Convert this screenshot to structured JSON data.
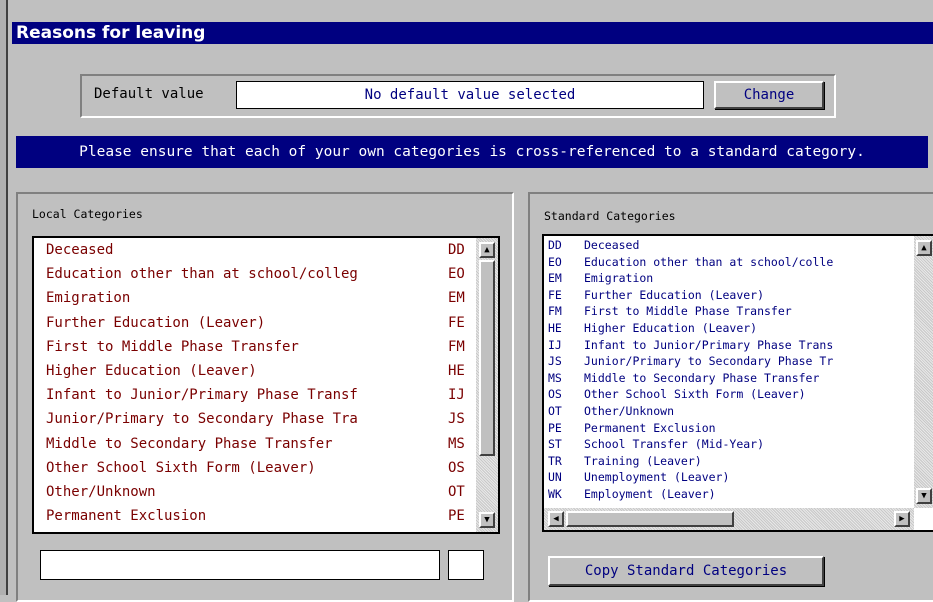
{
  "window": {
    "title": "Reasons for leaving"
  },
  "default_value": {
    "label": "Default value",
    "value": "No default value selected",
    "change_button": "Change"
  },
  "banner": "Please ensure that each of your own categories is cross-referenced to a standard category.",
  "local": {
    "title": "Local Categories",
    "items": [
      {
        "name": "Deceased",
        "code": "DD"
      },
      {
        "name": "Education other than at school/colleg",
        "code": "EO"
      },
      {
        "name": "Emigration",
        "code": "EM"
      },
      {
        "name": "Further Education (Leaver)",
        "code": "FE"
      },
      {
        "name": "First to Middle Phase Transfer",
        "code": "FM"
      },
      {
        "name": "Higher Education (Leaver)",
        "code": "HE"
      },
      {
        "name": "Infant to Junior/Primary Phase Transf",
        "code": "IJ"
      },
      {
        "name": "Junior/Primary to Secondary Phase Tra",
        "code": "JS"
      },
      {
        "name": "Middle to Secondary Phase Transfer",
        "code": "MS"
      },
      {
        "name": "Other School Sixth Form (Leaver)",
        "code": "OS"
      },
      {
        "name": "Other/Unknown",
        "code": "OT"
      },
      {
        "name": "Permanent Exclusion",
        "code": "PE"
      }
    ],
    "edit_name": "",
    "edit_code": ""
  },
  "standard": {
    "title": "Standard Categories",
    "items": [
      {
        "code": "DD",
        "name": "Deceased"
      },
      {
        "code": "EO",
        "name": "Education other than at school/colle"
      },
      {
        "code": "EM",
        "name": "Emigration"
      },
      {
        "code": "FE",
        "name": "Further Education (Leaver)"
      },
      {
        "code": "FM",
        "name": "First to Middle Phase Transfer"
      },
      {
        "code": "HE",
        "name": "Higher Education (Leaver)"
      },
      {
        "code": "IJ",
        "name": "Infant to Junior/Primary Phase Trans"
      },
      {
        "code": "JS",
        "name": "Junior/Primary to Secondary Phase Tr"
      },
      {
        "code": "MS",
        "name": "Middle to Secondary Phase Transfer"
      },
      {
        "code": "OS",
        "name": "Other School Sixth Form (Leaver)"
      },
      {
        "code": "OT",
        "name": "Other/Unknown"
      },
      {
        "code": "PE",
        "name": "Permanent Exclusion"
      },
      {
        "code": "ST",
        "name": "School Transfer (Mid-Year)"
      },
      {
        "code": "TR",
        "name": "Training (Leaver)"
      },
      {
        "code": "UN",
        "name": "Unemployment (Leaver)"
      },
      {
        "code": "WK",
        "name": "Employment (Leaver)"
      }
    ],
    "copy_button": "Copy Standard Categories"
  },
  "icons": {
    "scroll_up": "▲",
    "scroll_down": "▼",
    "scroll_left": "◀",
    "scroll_right": "▶"
  },
  "colors": {
    "title_bar": "#000080",
    "local_text": "#7a0000",
    "standard_text": "#000080"
  }
}
